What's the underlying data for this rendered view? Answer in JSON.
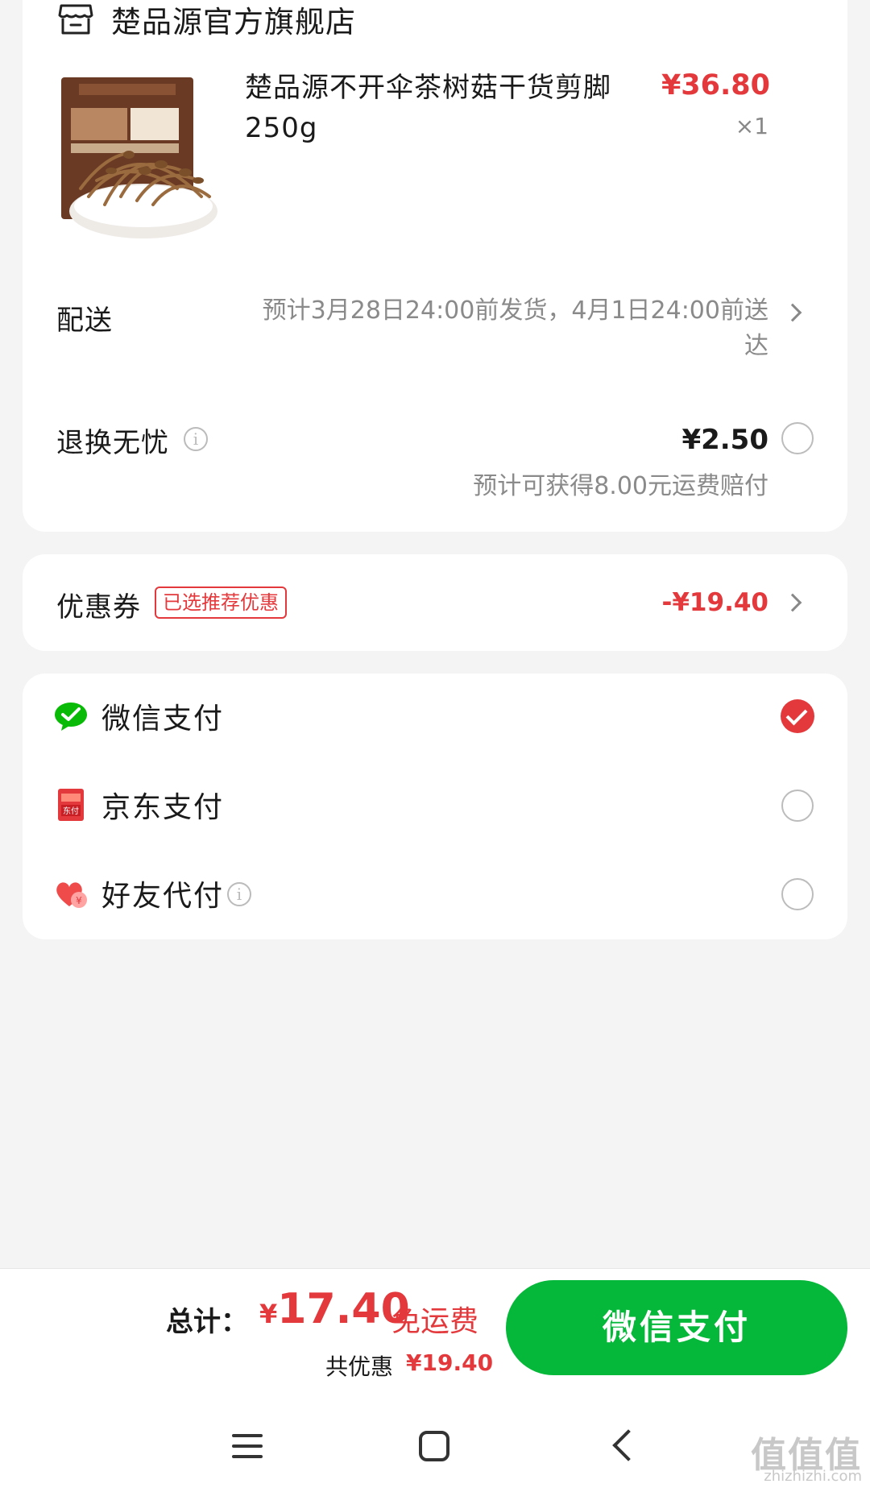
{
  "shop": {
    "name": "楚品源官方旗舰店",
    "icon": "store-icon"
  },
  "product": {
    "title": "楚品源不开伞茶树菇干货剪脚250g",
    "price": "¥36.80",
    "quantity": "×1",
    "image": "product-mushroom-image"
  },
  "delivery": {
    "label": "配送",
    "text": "预计3月28日24:00前发货，4月1日24:00前送达"
  },
  "return_service": {
    "label": "退换无忧",
    "price": "¥2.50",
    "note": "预计可获得8.00元运费赔付"
  },
  "coupon": {
    "label": "优惠券",
    "badge": "已选推荐优惠",
    "amount": "-¥19.40"
  },
  "payment_methods": [
    {
      "label": "微信支付",
      "icon": "wechat-pay-icon",
      "selected": true
    },
    {
      "label": "京东支付",
      "icon": "jd-pay-icon",
      "selected": false
    },
    {
      "label": "好友代付",
      "icon": "friend-pay-icon",
      "selected": false
    }
  ],
  "footer": {
    "total_label": "总计：",
    "total_currency": "¥",
    "total_value": "17.40",
    "free_shipping": "免运费",
    "discount_label": "共优惠",
    "discount_value": "¥19.40",
    "pay_button": "微信支付"
  },
  "watermark": {
    "text": "值值值",
    "sub": "zhizhizhi.com"
  },
  "colors": {
    "accent_red": "#e4393c",
    "wechat_green": "#06b83a",
    "background": "#f4f4f4"
  }
}
